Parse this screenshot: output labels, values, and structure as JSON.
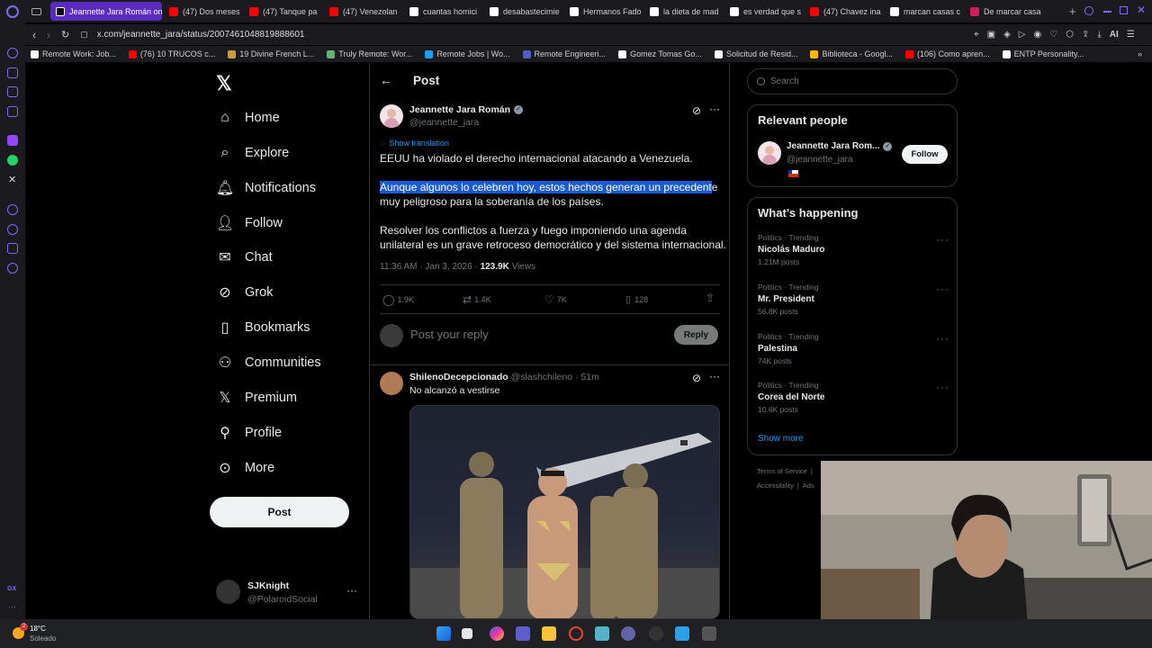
{
  "browser": {
    "tabs": [
      {
        "label": "Jeannette Jara Román on ",
        "color": "#000000",
        "active": true
      },
      {
        "label": "(47) Dos meses",
        "color": "#ff0000"
      },
      {
        "label": "(47) Tanque pa",
        "color": "#ff0000"
      },
      {
        "label": "(47) Venezolan",
        "color": "#ff0000"
      },
      {
        "label": "cuantas homici",
        "color": "#ffffff"
      },
      {
        "label": "desabastecimie",
        "color": "#ffffff"
      },
      {
        "label": "Hermanos Fado",
        "color": "#ffffff"
      },
      {
        "label": "la dieta de mad",
        "color": "#ffffff"
      },
      {
        "label": "es verdad que s",
        "color": "#ffffff"
      },
      {
        "label": "(47) Chavez ina",
        "color": "#ff0000"
      },
      {
        "label": "marcan casas c",
        "color": "#ffffff"
      },
      {
        "label": "De marcar casa",
        "color": "#d11e5a"
      }
    ],
    "url": "x.com/jeannette_jara/status/2007461048819888601",
    "ai_label": "AI",
    "bookmarks": [
      {
        "label": "Remote Work: Job...",
        "color": "#ffffff"
      },
      {
        "label": "(76) 10 TRUCOS c...",
        "color": "#ff0000"
      },
      {
        "label": "19 Divine French L...",
        "color": "#c9a227"
      },
      {
        "label": "Truly Remote: Wor...",
        "color": "#5bb974"
      },
      {
        "label": "Remote Jobs | Wo...",
        "color": "#1da1f2"
      },
      {
        "label": "Remote Engineeri...",
        "color": "#4f5bd5"
      },
      {
        "label": "Gomez Tomas Go...",
        "color": "#ffffff"
      },
      {
        "label": "Solicitud de Resid...",
        "color": "#ffffff"
      },
      {
        "label": "Biblioteca - Googl...",
        "color": "#fbbc04"
      },
      {
        "label": "(106) Como apren...",
        "color": "#ff0000"
      },
      {
        "label": "ENTP Personality...",
        "color": "#ffffff"
      }
    ]
  },
  "nav": {
    "items": [
      {
        "label": "Home",
        "icon": "home-icon"
      },
      {
        "label": "Explore",
        "icon": "search-icon"
      },
      {
        "label": "Notifications",
        "icon": "bell-icon"
      },
      {
        "label": "Follow",
        "icon": "follow-icon"
      },
      {
        "label": "Chat",
        "icon": "mail-icon"
      },
      {
        "label": "Grok",
        "icon": "grok-icon"
      },
      {
        "label": "Bookmarks",
        "icon": "bookmark-icon"
      },
      {
        "label": "Communities",
        "icon": "communities-icon"
      },
      {
        "label": "Premium",
        "icon": "x-logo-icon"
      },
      {
        "label": "Profile",
        "icon": "person-icon"
      },
      {
        "label": "More",
        "icon": "more-circle-icon"
      }
    ],
    "post_button": "Post",
    "account": {
      "name": "SJKnight",
      "handle": "@PolaroidSocial"
    }
  },
  "post": {
    "header": "Post",
    "author": "Jeannette Jara Román",
    "handle": "@jeannette_jara",
    "show_translation": "Show translation",
    "p1": "EEUU ha violado el derecho internacional atacando  a Venezuela.",
    "p2_selected": "Aunque algunos lo celebren hoy, estos hechos generan  un precedent",
    "p2_rest": "e",
    "p2_line2": "muy peligroso para la soberanía de los países.",
    "p3_line1": "Resolver los conflictos a fuerza y fuego imponiendo una agenda",
    "p3_line2": "unilateral es un grave retroceso democrático y del sistema internacional.",
    "time": "11:36 AM · Jan 3, 2026 · ",
    "views": "123.9K",
    "views_label": " Views",
    "stats": {
      "replies": "1.9K",
      "reposts": "1.4K",
      "likes": "7K",
      "bookmarks": "128"
    },
    "reply_placeholder": "Post your reply",
    "reply_button": "Reply"
  },
  "reply": {
    "author": "ShilenoDecepcionado",
    "handle": "@slashchileno",
    "time": "· 51m",
    "text": "No alcanzó a vestirse"
  },
  "right": {
    "search_placeholder": "Search",
    "relevant_title": "Relevant people",
    "person_name": "Jeannette Jara Rom...",
    "person_handle": "@jeannette_jara",
    "follow": "Follow",
    "happening_title": "What’s happening",
    "trends": [
      {
        "category": "Politics · Trending",
        "name": "Nicolás Maduro",
        "count": "1.21M posts"
      },
      {
        "category": "Politics · Trending",
        "name": "Mr. President",
        "count": "56.8K posts"
      },
      {
        "category": "Politics · Trending",
        "name": "Palestina",
        "count": "74K posts"
      },
      {
        "category": "Politics · Trending",
        "name": "Corea del Norte",
        "count": "10.6K posts"
      }
    ],
    "show_more": "Show more",
    "footer1": "Terms of Service",
    "footer2": "Accessibility",
    "footer3": "Ads"
  },
  "taskbar": {
    "temp": "18°C",
    "weather": "Soleado",
    "badge": "2"
  },
  "sidebar_label": "GX",
  "colors": {
    "accent": "#1d9bf0",
    "selection": "#1a5ad7",
    "opera_tab": "#5b2bbf"
  }
}
